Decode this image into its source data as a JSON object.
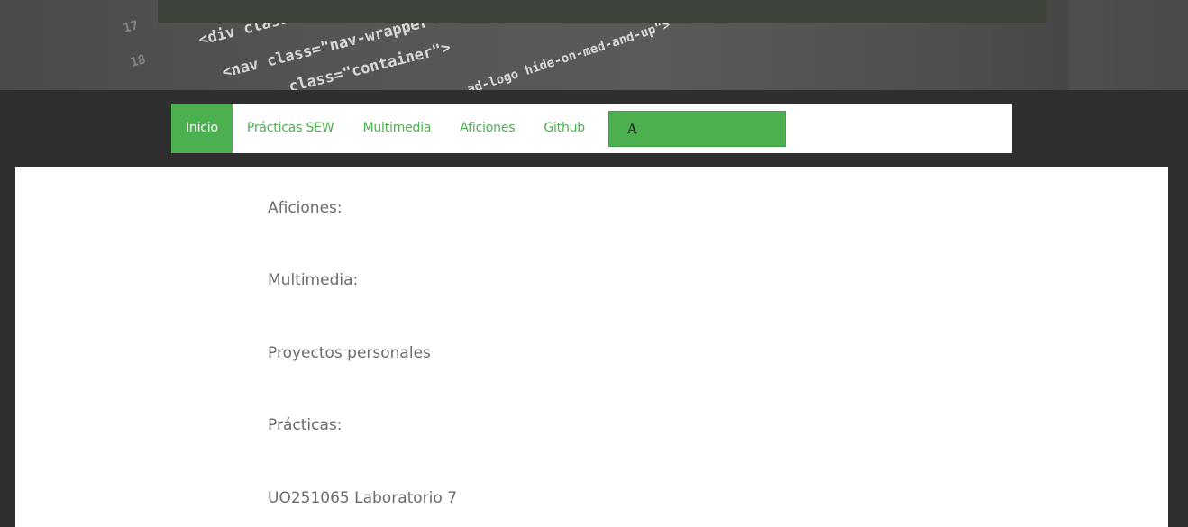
{
  "hero": {
    "code_lines": [
      "<div class=\"nav\">",
      "<nav class=\"nav-wrapper\">",
      "class=\"container\">",
      "ad-logo hide-on-med-and-up\">"
    ],
    "line_numbers": [
      "17",
      "18"
    ]
  },
  "nav": {
    "items": [
      {
        "label": "Inicio",
        "active": true
      },
      {
        "label": "Prácticas SEW",
        "active": false
      },
      {
        "label": "Multimedia",
        "active": false
      },
      {
        "label": "Aficiones",
        "active": false
      },
      {
        "label": "Github",
        "active": false
      }
    ],
    "search": {
      "value": "A",
      "placeholder": ""
    }
  },
  "content": {
    "items": [
      "Aficiones:",
      "Multimedia:",
      "Proyectos personales",
      "Prácticas:",
      "UO251065 Laboratorio 7"
    ]
  },
  "colors": {
    "accent": "#4caf50",
    "background": "#2f2f2f",
    "text_muted": "#6b6b6b"
  }
}
